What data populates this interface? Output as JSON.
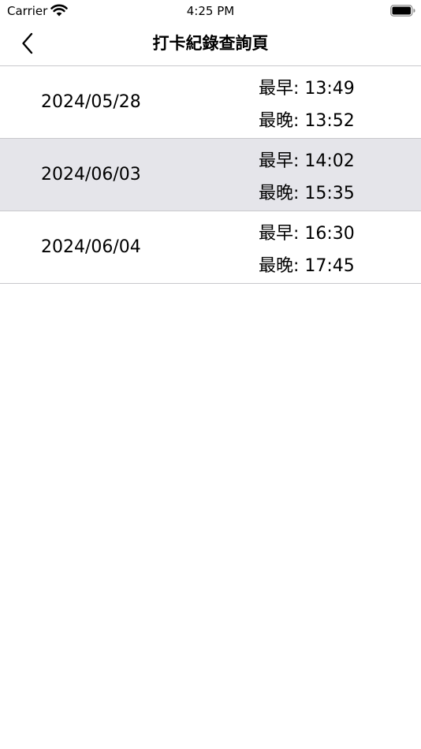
{
  "status_bar": {
    "carrier": "Carrier",
    "time": "4:25 PM"
  },
  "nav": {
    "title": "打卡紀錄查詢頁",
    "back_icon": "chevron-left-icon"
  },
  "records": [
    {
      "date": "2024/05/28",
      "earliest": "最早: 13:49",
      "latest": "最晚: 13:52",
      "selected": false
    },
    {
      "date": "2024/06/03",
      "earliest": "最早: 14:02",
      "latest": "最晚: 15:35",
      "selected": true
    },
    {
      "date": "2024/06/04",
      "earliest": "最早: 16:30",
      "latest": "最晚: 17:45",
      "selected": false
    }
  ],
  "colors": {
    "selected_row": "#e5e5ea",
    "separator": "#c8c8cc"
  }
}
